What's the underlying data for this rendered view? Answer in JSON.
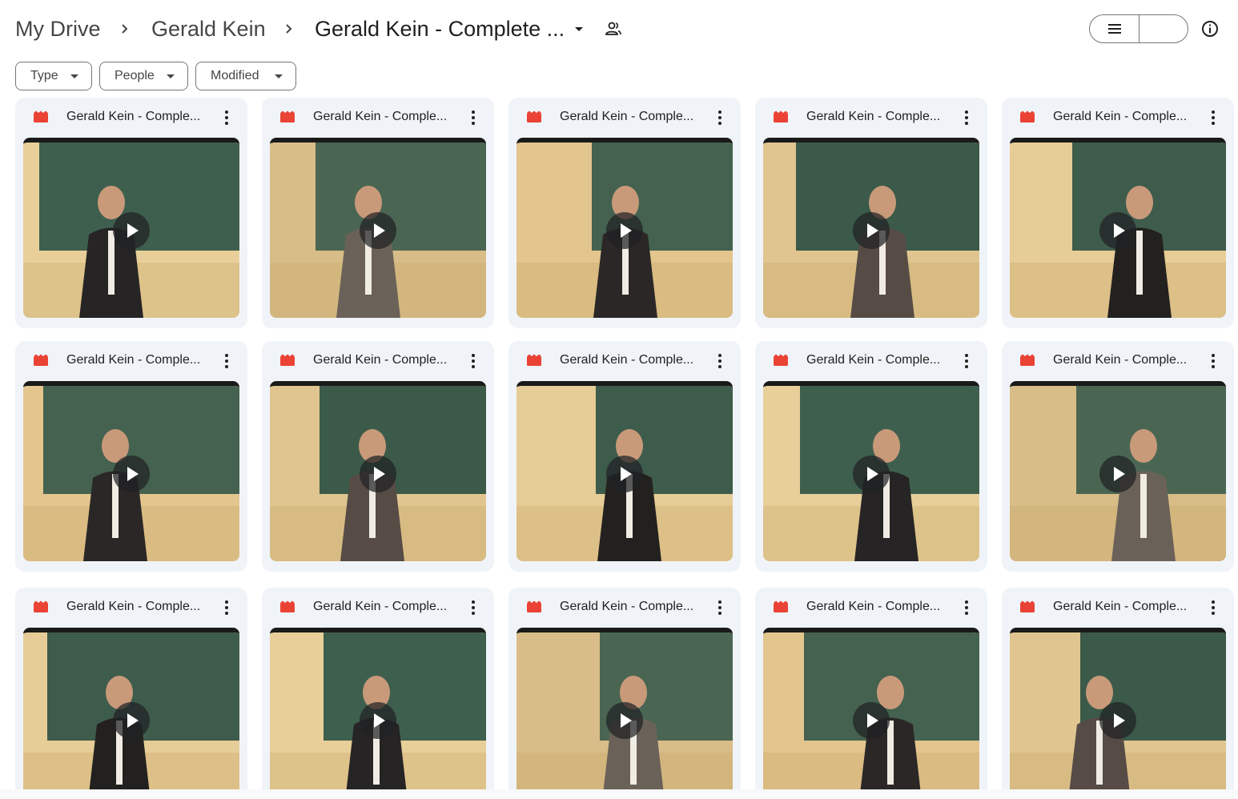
{
  "breadcrumb": {
    "items": [
      {
        "label": "My Drive"
      },
      {
        "label": "Gerald Kein"
      },
      {
        "label": "Gerald Kein - Complete ..."
      }
    ]
  },
  "icons": {
    "separator": "chevron-right-icon",
    "folder_menu": "caret-down-icon",
    "shared": "people-icon",
    "list_view": "list-view-icon",
    "grid_view": "grid-view-icon",
    "checkmark": "check-icon",
    "details": "info-icon",
    "file_type": "video-file-icon",
    "more": "more-vert-icon",
    "play": "play-icon"
  },
  "view_toggle": {
    "selected": "grid"
  },
  "filters": [
    {
      "label": "Type"
    },
    {
      "label": "People"
    },
    {
      "label": "Modified"
    }
  ],
  "colors": {
    "video_icon": "#ea4335",
    "toggle_selected": "#c2e7ff",
    "card_bg": "#f0f4f9"
  },
  "files": [
    {
      "name": "Gerald Kein - Comple..."
    },
    {
      "name": "Gerald Kein - Comple..."
    },
    {
      "name": "Gerald Kein - Comple..."
    },
    {
      "name": "Gerald Kein - Comple..."
    },
    {
      "name": "Gerald Kein - Comple..."
    },
    {
      "name": "Gerald Kein - Comple..."
    },
    {
      "name": "Gerald Kein - Comple..."
    },
    {
      "name": "Gerald Kein - Comple..."
    },
    {
      "name": "Gerald Kein - Comple..."
    },
    {
      "name": "Gerald Kein - Comple..."
    },
    {
      "name": "Gerald Kein - Comple..."
    },
    {
      "name": "Gerald Kein - Comple..."
    },
    {
      "name": "Gerald Kein - Comple..."
    },
    {
      "name": "Gerald Kein - Comple..."
    },
    {
      "name": "Gerald Kein - Comple..."
    }
  ]
}
